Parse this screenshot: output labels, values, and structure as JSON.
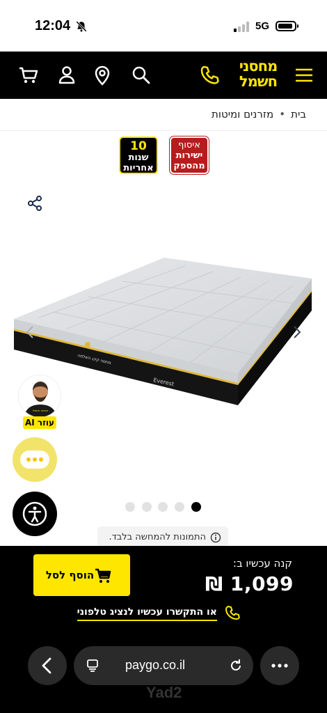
{
  "status_bar": {
    "time": "12:04",
    "network": "5G",
    "bell_icon": "bell-slash-icon"
  },
  "header": {
    "logo_line1": "מחסני",
    "logo_line2": "חשמל",
    "brand_color": "#ffe600",
    "icons": [
      "menu-icon",
      "phone-icon",
      "search-icon",
      "location-icon",
      "user-icon",
      "cart-icon"
    ]
  },
  "breadcrumb": {
    "home": "בית",
    "separator": "•",
    "category": "מזרנים ומיטות"
  },
  "badges": {
    "warranty_number": "10",
    "warranty_line2": "שנות",
    "warranty_line3": "אחריות",
    "pickup_line1": "איסוף",
    "pickup_line2": "ישירות",
    "pickup_line3": "מהספק"
  },
  "product": {
    "brand_text": "Everest",
    "mattress_logo_text": "מחסני קינג השלמה",
    "carousel_total": 5,
    "carousel_active_index": 4
  },
  "ai_helper": {
    "label": "עוזר AI",
    "shirt_text": "מחסני חשמל"
  },
  "disclaimer": "התמונות להמחשה בלבד.",
  "buy_bar": {
    "buy_label": "קנה עכשיו ב:",
    "price": "1,099 ₪",
    "add_to_cart": "הוסף לסל",
    "contact": "או התקשרו עכשיו לנציג טלפוני"
  },
  "browser": {
    "url": "paygo.co.il"
  },
  "watermark": "Yad2"
}
